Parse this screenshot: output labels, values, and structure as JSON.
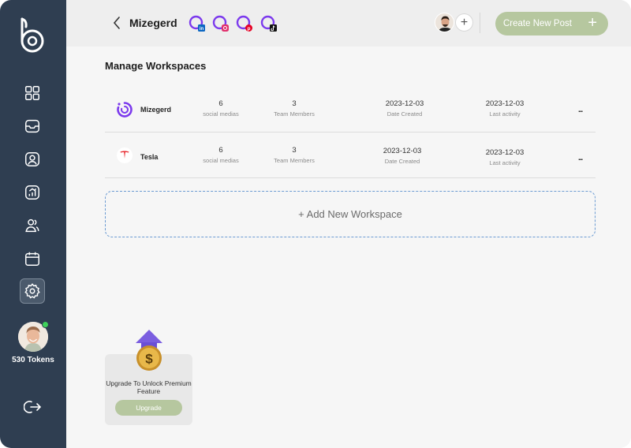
{
  "sidebar": {
    "nav": [
      {
        "icon": "grid-icon"
      },
      {
        "icon": "inbox-icon"
      },
      {
        "icon": "user-profile-icon"
      },
      {
        "icon": "analytics-icon"
      },
      {
        "icon": "users-icon"
      },
      {
        "icon": "calendar-icon"
      },
      {
        "icon": "settings-icon",
        "active": true
      }
    ],
    "tokens": "530 Tokens",
    "online_color": "#3ed15a"
  },
  "header": {
    "workspace": "Mizegerd",
    "socials": [
      "linkedin-icon",
      "instagram-icon",
      "pinterest-icon",
      "tiktok-icon"
    ],
    "create_button": "Create New Post",
    "create_plus": "+",
    "add_member": "+"
  },
  "page": {
    "title": "Manage Workspaces",
    "add_workspace": "+ Add New Workspace"
  },
  "workspaces": [
    {
      "name": "Mizegerd",
      "social_medias": "6",
      "social_medias_label": "social medias",
      "team_members": "3",
      "team_members_label": "Team Members",
      "date_created": "2023-12-03",
      "date_created_label": "Date Created",
      "last_activity": "2023-12-03",
      "last_activity_label": "Last activity",
      "menu": "..."
    },
    {
      "name": "Tesla",
      "social_medias": "6",
      "social_medias_label": "social medias",
      "team_members": "3",
      "team_members_label": "Team Members",
      "date_created": "2023-12-03",
      "date_created_label": "Date Created",
      "last_activity": "2023-12-03",
      "last_activity_label": "Last activity",
      "menu": "..."
    }
  ],
  "upgrade": {
    "text": "Upgrade To Unlock Premium Feature",
    "button": "Upgrade",
    "coin_symbol": "$"
  },
  "colors": {
    "sidebar": "#2f3e51",
    "accent_green": "#b6c79f",
    "brand_purple": "#7c3aed",
    "dashed_border": "#6b9bd2"
  }
}
